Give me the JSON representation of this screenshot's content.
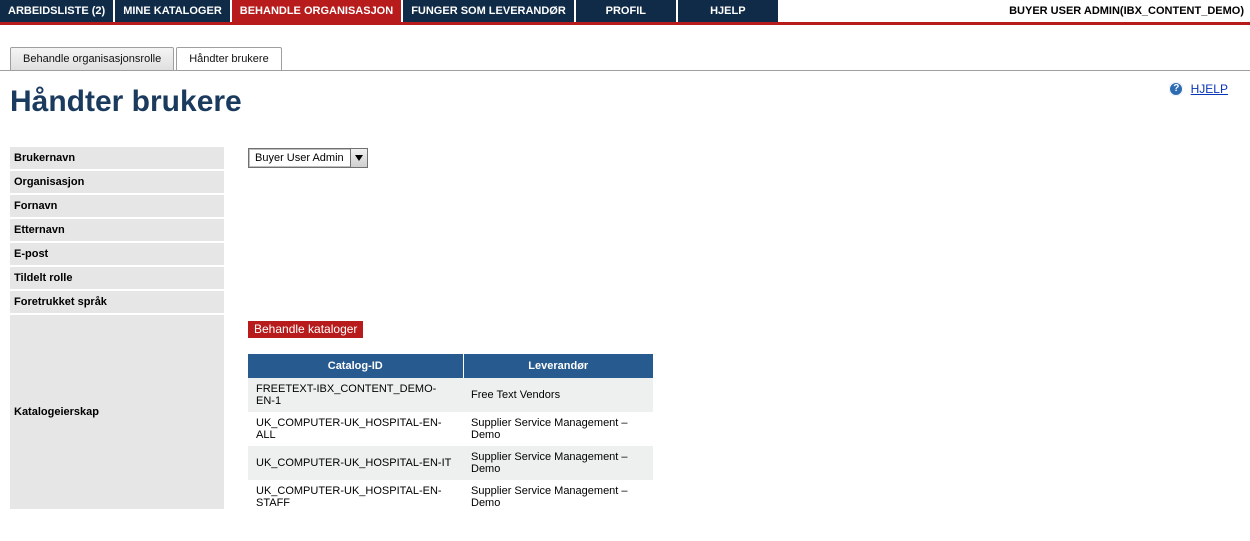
{
  "header": {
    "nav": [
      {
        "label": "ARBEIDSLISTE (2)",
        "active": false
      },
      {
        "label": "MINE KATALOGER",
        "active": false
      },
      {
        "label": "BEHANDLE ORGANISASJON",
        "active": true
      },
      {
        "label": "FUNGER SOM LEVERANDØR",
        "active": false
      },
      {
        "label": "PROFIL",
        "active": false
      },
      {
        "label": "HJELP",
        "active": false
      }
    ],
    "user_info": "BUYER USER ADMIN(IBX_CONTENT_DEMO)"
  },
  "tabs": [
    {
      "label": "Behandle organisasjonsrolle",
      "active": false
    },
    {
      "label": "Håndter brukere",
      "active": true
    }
  ],
  "help": {
    "icon_glyph": "?",
    "label": "HJELP"
  },
  "page": {
    "title": "Håndter brukere"
  },
  "form": {
    "fields": {
      "brukernavn": {
        "label": "Brukernavn",
        "selected": "Buyer User Admin"
      },
      "organisasjon": {
        "label": "Organisasjon"
      },
      "fornavn": {
        "label": "Fornavn"
      },
      "etternavn": {
        "label": "Etternavn"
      },
      "epost": {
        "label": "E-post"
      },
      "tildelt_rolle": {
        "label": "Tildelt rolle"
      },
      "foretrukket_sprak": {
        "label": "Foretrukket språk"
      }
    },
    "catalog_section": {
      "label": "Katalogeierskap",
      "heading": "Behandle kataloger",
      "columns": [
        "Catalog-ID",
        "Leverandør"
      ],
      "rows": [
        {
          "id": "FREETEXT-IBX_CONTENT_DEMO-EN-1",
          "vendor": "Free Text Vendors"
        },
        {
          "id": "UK_COMPUTER-UK_HOSPITAL-EN-ALL",
          "vendor": "Supplier Service Management – Demo"
        },
        {
          "id": "UK_COMPUTER-UK_HOSPITAL-EN-IT",
          "vendor": "Supplier Service Management – Demo"
        },
        {
          "id": "UK_COMPUTER-UK_HOSPITAL-EN-STAFF",
          "vendor": "Supplier Service Management – Demo"
        }
      ]
    }
  }
}
